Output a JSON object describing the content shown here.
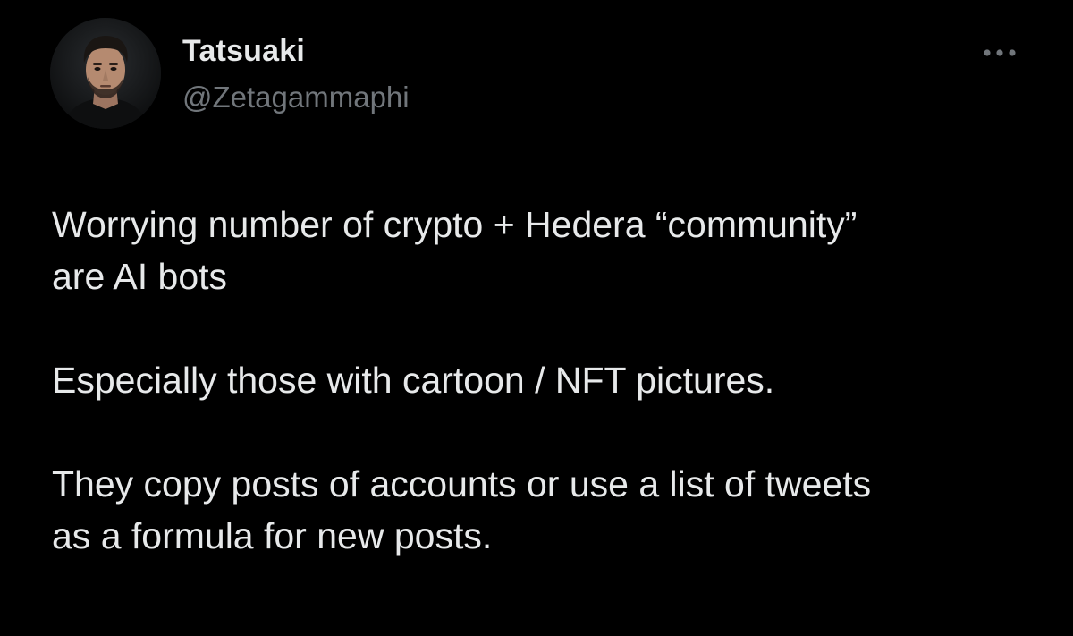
{
  "author": {
    "display_name": "Tatsuaki",
    "handle": "@Zetagammaphi",
    "avatar_icon": "profile-photo-avatar"
  },
  "header": {
    "more_icon": "more-horizontal-icon"
  },
  "tweet": {
    "paragraphs": [
      "Worrying number of crypto + Hedera “community”\nare AI bots",
      "Especially those with cartoon / NFT pictures.",
      "They copy posts of accounts or use a list of tweets\nas a formula for new posts."
    ]
  },
  "colors": {
    "background": "#000000",
    "primary_text": "#e7e9ea",
    "secondary_text": "#71767b"
  }
}
